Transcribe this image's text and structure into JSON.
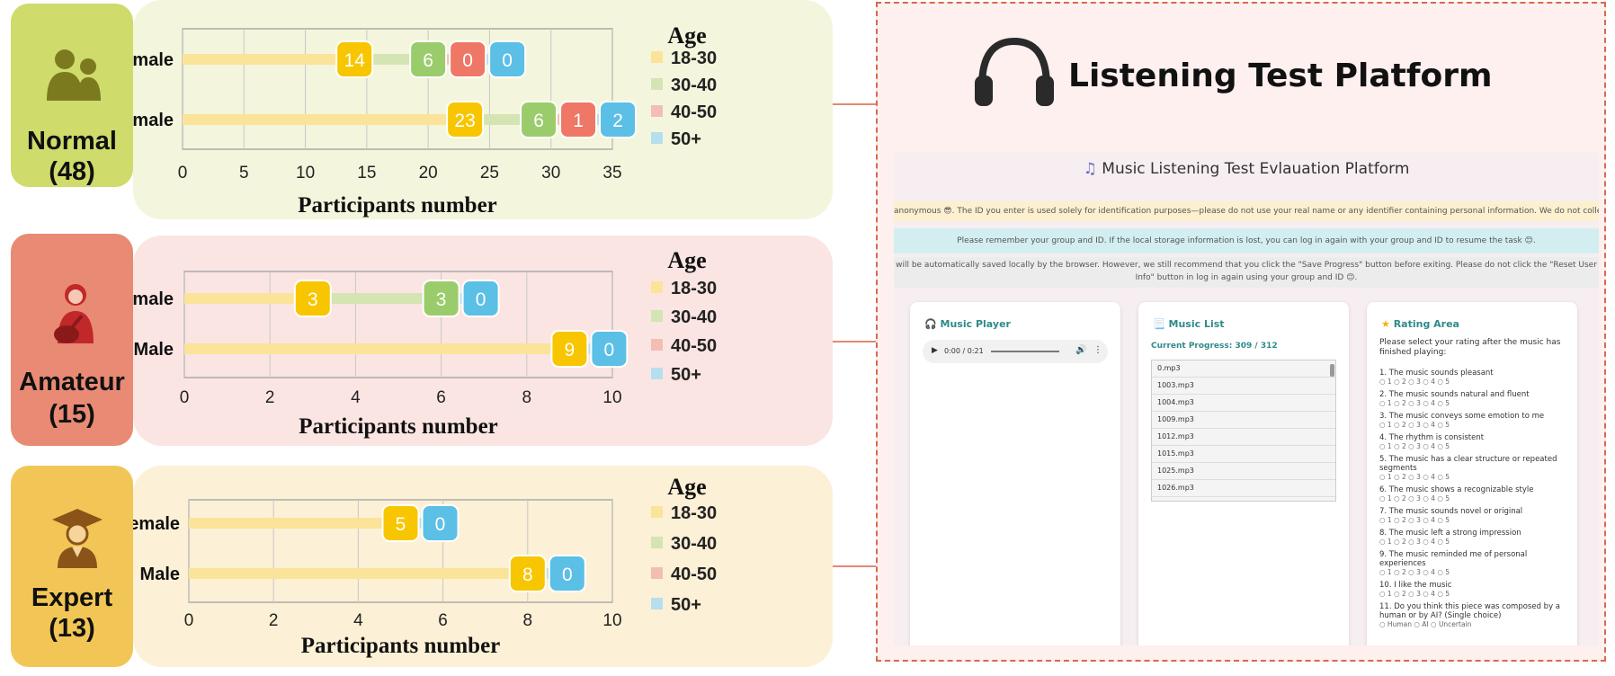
{
  "groups": [
    {
      "name": "Normal",
      "count": "(48)",
      "icon": "people-icon",
      "label_color": "#cfdb6a",
      "panel_color": "#f3f6dc",
      "label_top": 4,
      "label_h": 204
    },
    {
      "name": "Amateur",
      "count": "(15)",
      "icon": "guitarist-icon",
      "label_color": "#e98a74",
      "panel_color": "#fbe5e2",
      "label_top": 260,
      "label_h": 236
    },
    {
      "name": "Expert",
      "count": "(13)",
      "icon": "graduate-icon",
      "label_color": "#f1c656",
      "panel_color": "#fcf0d6",
      "label_top": 518,
      "label_h": 224
    }
  ],
  "legend": {
    "title": "Age",
    "entries": [
      {
        "label": "18-30",
        "color": "#f7c600"
      },
      {
        "label": "30-40",
        "color": "#9bcc6b"
      },
      {
        "label": "40-50",
        "color": "#ee7766"
      },
      {
        "label": "50+",
        "color": "#5bbfe6"
      }
    ]
  },
  "chart_data": [
    {
      "type": "bar",
      "group": "Normal",
      "xlabel": "Participants number",
      "xlim": [
        0,
        35
      ],
      "xticks": [
        0,
        5,
        10,
        15,
        20,
        25,
        30,
        35
      ],
      "categories": [
        "female",
        "male"
      ],
      "series": [
        {
          "name": "18-30",
          "values": [
            14,
            23
          ]
        },
        {
          "name": "30-40",
          "values": [
            6,
            6
          ]
        },
        {
          "name": "40-50",
          "values": [
            0,
            1
          ]
        },
        {
          "name": "50+",
          "values": [
            0,
            2
          ]
        }
      ]
    },
    {
      "type": "bar",
      "group": "Amateur",
      "xlabel": "Participants number",
      "xlim": [
        0,
        10
      ],
      "xticks": [
        0,
        2,
        4,
        6,
        8,
        10
      ],
      "categories": [
        "female",
        "Male"
      ],
      "series": [
        {
          "name": "18-30",
          "values": [
            3,
            9
          ]
        },
        {
          "name": "30-40",
          "values": [
            3,
            null
          ]
        },
        {
          "name": "50+",
          "values": [
            0,
            0
          ]
        }
      ]
    },
    {
      "type": "bar",
      "group": "Expert",
      "xlabel": "Participants number",
      "xlim": [
        0,
        10
      ],
      "xticks": [
        0,
        2,
        4,
        6,
        8,
        10
      ],
      "categories": [
        "female",
        "Male"
      ],
      "series": [
        {
          "name": "18-30",
          "values": [
            5,
            8
          ]
        },
        {
          "name": "50+",
          "values": [
            0,
            0
          ]
        }
      ]
    }
  ],
  "platform": {
    "title": "Listening Test Platform",
    "screenshot_title": "Music Listening Test Evlauation Platform",
    "notice_yellow": "anonymous 😎. The ID you enter is used solely for identification purposes—please do not use your real name or any identifier containing personal information. We do not collect any personal",
    "notice_blue": "Please remember your group and ID. If the local storage information is lost, you can log in again with your group and ID to resume the task 😊.",
    "notice_grey": "will be automatically saved locally by the browser. However, we still recommend that you click the \"Save Progress\" button before exiting. Please do not click the \"Reset User Info\" button in log in again using your group and ID 😊.",
    "player": {
      "title": "Music Player",
      "time": "0:00 / 0:21"
    },
    "music_list": {
      "title": "Music List",
      "progress": "Current Progress: 309 / 312",
      "items": [
        "0.mp3",
        "1003.mp3",
        "1004.mp3",
        "1009.mp3",
        "1012.mp3",
        "1015.mp3",
        "1025.mp3",
        "1026.mp3"
      ]
    },
    "rating": {
      "title": "Rating Area",
      "intro": "Please select your rating after the music has finished playing:",
      "scale": "○ 1 ○ 2 ○ 3 ○ 4 ○ 5",
      "questions": [
        "1. The music sounds pleasant",
        "2. The music sounds natural and fluent",
        "3. The music conveys some emotion to me",
        "4. The rhythm is consistent",
        "5. The music has a clear structure or repeated segments",
        "6. The music shows a recognizable style",
        "7. The music sounds novel or original",
        "8. The music left a strong impression",
        "9. The music reminded me of personal experiences",
        "10. I like the music"
      ],
      "last_question": "11. Do you think this piece was composed by a human or by AI? (Single choice)",
      "last_options": "○ Human ○ AI ○ Uncertain"
    }
  }
}
